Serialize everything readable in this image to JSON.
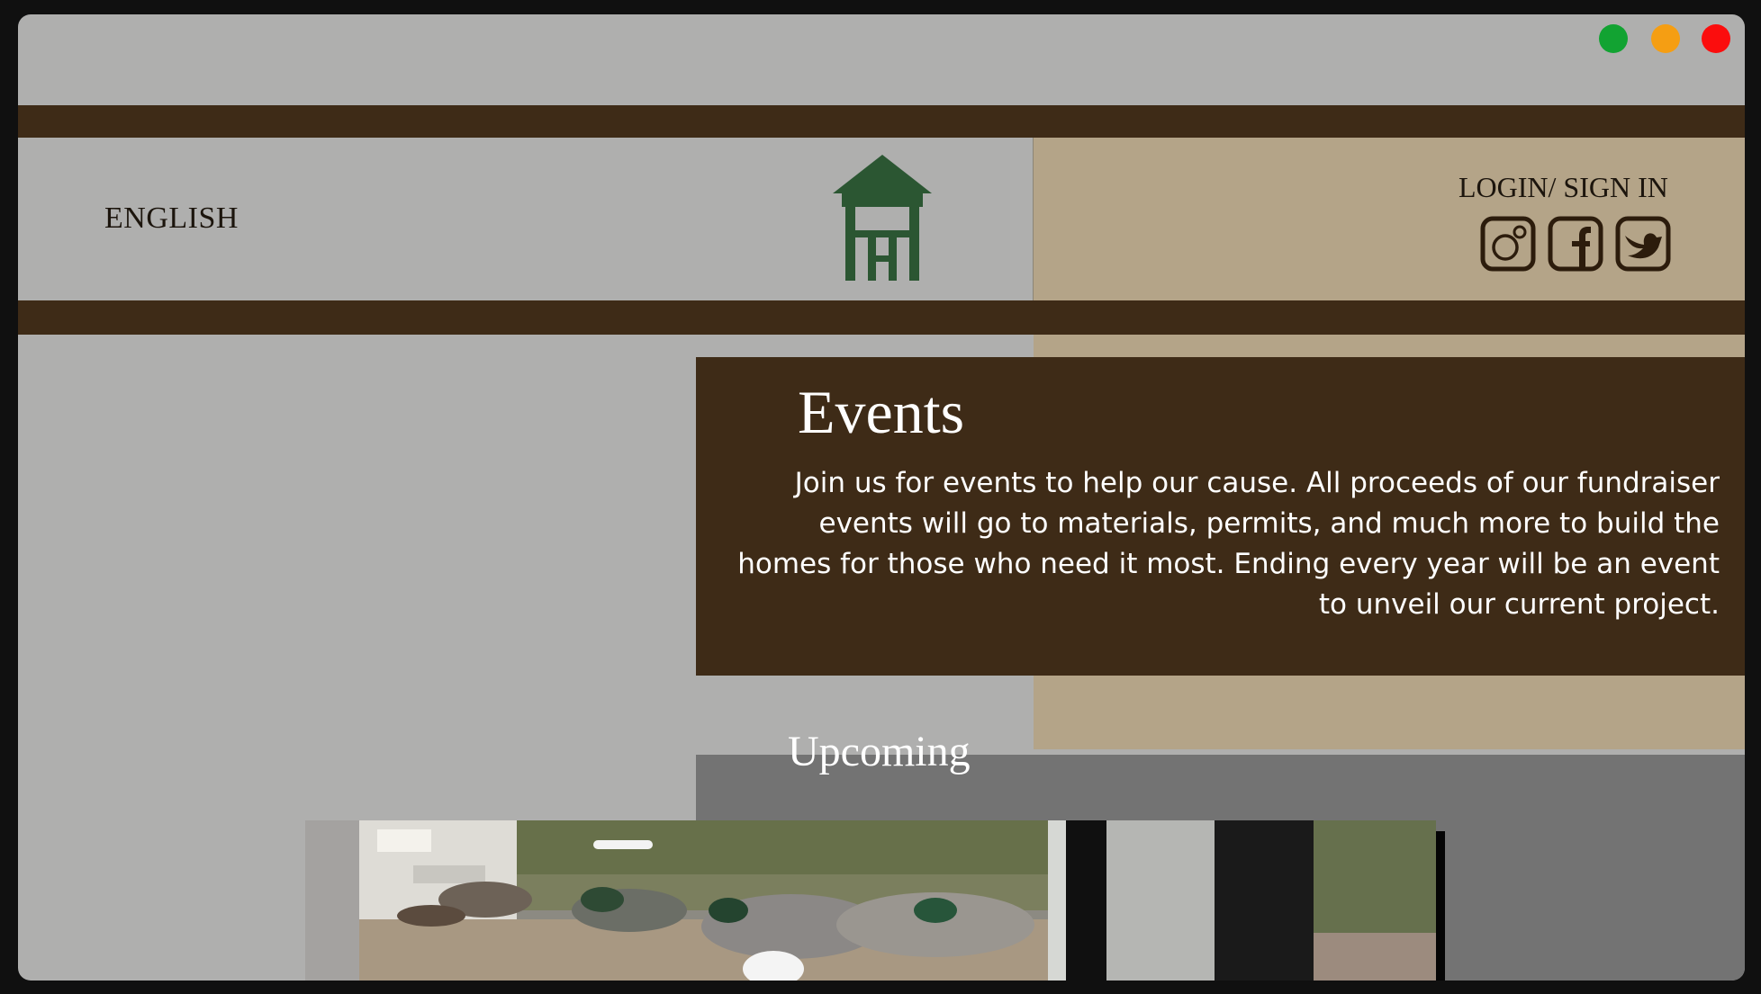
{
  "window_controls": [
    "maximize",
    "minimize",
    "close"
  ],
  "colors": {
    "brown": "#3e2b17",
    "tan": "#b4a488",
    "gray": "#afafae",
    "dark_gray": "#737373",
    "logo_green": "#2b5632"
  },
  "header": {
    "language": "ENGLISH",
    "login": "LOGIN/ SIGN IN",
    "logo_icon": "house-logo-icon",
    "social_icons": [
      "instagram-icon",
      "facebook-icon",
      "twitter-icon"
    ]
  },
  "events": {
    "title": "Events",
    "description": "Join us for events to help our cause. All proceeds of our fundraiser events will go to materials, permits, and much more to build the homes for those who need it most. Ending every year will be an event to unveil our current project."
  },
  "upcoming": {
    "title": "Upcoming",
    "photo": "ducks-photo"
  }
}
